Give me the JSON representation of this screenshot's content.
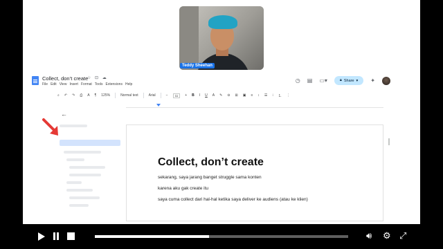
{
  "webcam": {
    "name": "Teddy Sheehan"
  },
  "docs": {
    "title": "Collect, don’t create",
    "title_icons": "☆ ⊡ ☁",
    "menus": [
      "File",
      "Edit",
      "View",
      "Insert",
      "Format",
      "Tools",
      "Extensions",
      "Help"
    ],
    "share_label": "Share"
  },
  "toolbar": {
    "zoom": "125%",
    "style": "Normal text",
    "font": "Arial",
    "size": "11"
  },
  "document": {
    "heading": "Collect, don’t create",
    "lines": [
      "sekarang, saya jarang banget struggle sama konten",
      "karena aku gak create itu",
      "saya cuma collect dari hal-hal ketika saya deliver ke audiens (atau ke klien)"
    ]
  },
  "player": {
    "progress": 0.45
  },
  "colors": {
    "accent": "#4285f4",
    "share_bg": "#c2e7ff",
    "arrow": "#e53935"
  }
}
